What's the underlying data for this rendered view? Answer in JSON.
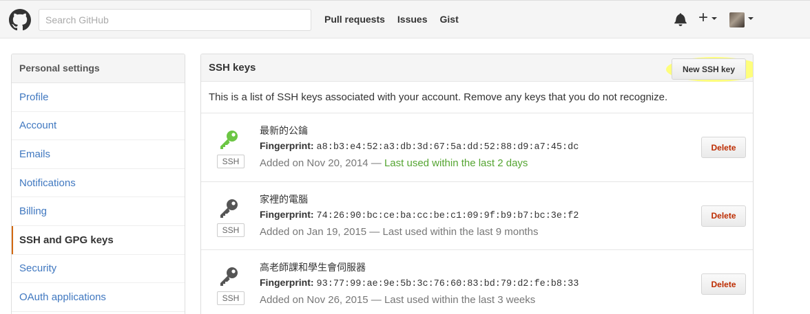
{
  "header": {
    "search_placeholder": "Search GitHub",
    "nav": [
      "Pull requests",
      "Issues",
      "Gist"
    ],
    "plus_label": "+"
  },
  "sidebar": {
    "title": "Personal settings",
    "items": [
      {
        "label": "Profile",
        "selected": false
      },
      {
        "label": "Account",
        "selected": false
      },
      {
        "label": "Emails",
        "selected": false
      },
      {
        "label": "Notifications",
        "selected": false
      },
      {
        "label": "Billing",
        "selected": false
      },
      {
        "label": "SSH and GPG keys",
        "selected": true
      },
      {
        "label": "Security",
        "selected": false
      },
      {
        "label": "OAuth applications",
        "selected": false
      }
    ]
  },
  "panel": {
    "title": "SSH keys",
    "new_key_button": "New SSH key",
    "intro": "This is a list of SSH keys associated with your account. Remove any keys that you do not recognize.",
    "ssh_badge": "SSH",
    "fingerprint_label": "Fingerprint:",
    "delete_label": "Delete",
    "keys": [
      {
        "title": "最新的公鑰",
        "fingerprint": "a8:b3:e4:52:a3:db:3d:67:5a:dd:52:88:d9:a7:45:dc",
        "added": "Added on Nov 20, 2014 — ",
        "last_used": "Last used within the last 2 days",
        "recent": true,
        "icon_color": "#6cc644"
      },
      {
        "title": "家裡的電腦",
        "fingerprint": "74:26:90:bc:ce:ba:cc:be:c1:09:9f:b9:b7:bc:3e:f2",
        "added": "Added on Jan 19, 2015 — ",
        "last_used": "Last used within the last 9 months",
        "recent": false,
        "icon_color": "#555555"
      },
      {
        "title": "高老師課和學生會伺服器",
        "fingerprint": "93:77:99:ae:9e:5b:3c:76:60:83:bd:79:d2:fe:b8:33",
        "added": "Added on Nov 26, 2015 — ",
        "last_used": "Last used within the last 3 weeks",
        "recent": false,
        "icon_color": "#555555"
      }
    ]
  },
  "colors": {
    "link": "#4078c0",
    "selected_bar": "#d26911",
    "recent": "#55a532",
    "delete": "#bd2c00",
    "highlight": "#ffff66"
  }
}
